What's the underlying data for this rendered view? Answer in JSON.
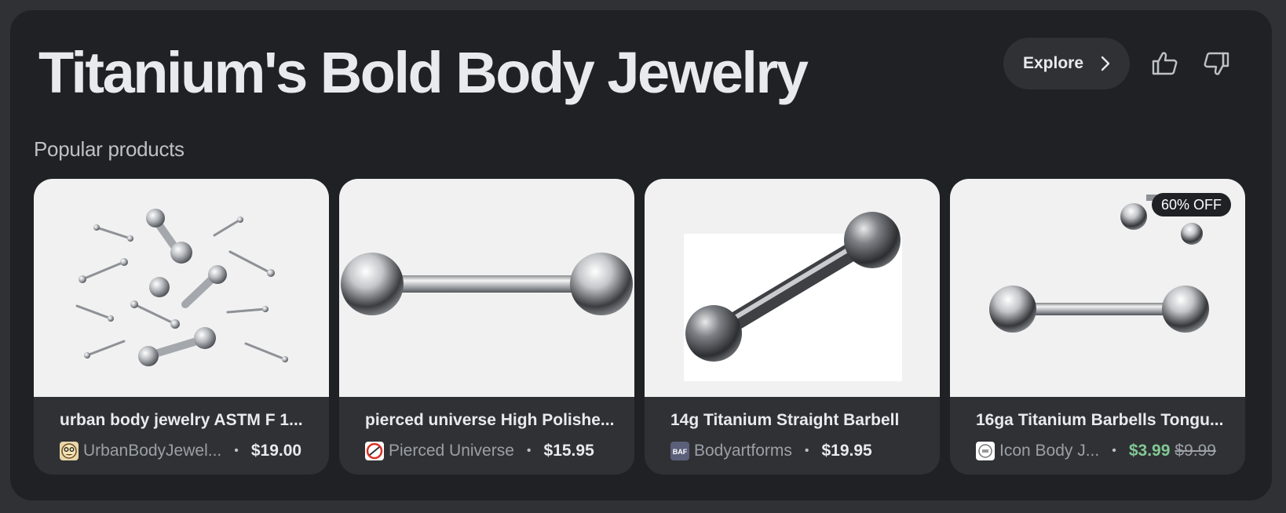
{
  "header": {
    "title": "Titanium's Bold Body Jewelry",
    "explore_label": "Explore"
  },
  "section": {
    "label": "Popular products"
  },
  "products": [
    {
      "title": "urban body jewelry ASTM F 1...",
      "merchant": "UrbanBodyJewel...",
      "price": "$19.00",
      "favicon_icon": "urbanbodyjewelry-favicon"
    },
    {
      "title": "pierced universe High Polishe...",
      "merchant": "Pierced Universe",
      "price": "$15.95",
      "favicon_icon": "pierced-universe-favicon"
    },
    {
      "title": "14g Titanium Straight Barbell",
      "merchant": "Bodyartforms",
      "price": "$19.95",
      "favicon_icon": "bodyartforms-favicon",
      "favicon_text": "BAF"
    },
    {
      "title": "16ga Titanium Barbells Tongu...",
      "merchant": "Icon Body J...",
      "price": "$3.99",
      "original_price": "$9.99",
      "badge": "60% OFF",
      "favicon_icon": "icon-body-jewelry-favicon"
    }
  ],
  "icons": {
    "explore": "chevron-right-icon",
    "feedback_positive": "thumbs-up-icon",
    "feedback_negative": "thumbs-down-icon"
  },
  "colors": {
    "page_background": "#303134",
    "panel_background": "#202124",
    "card_background": "#303134",
    "sale_price": "#81c995"
  }
}
